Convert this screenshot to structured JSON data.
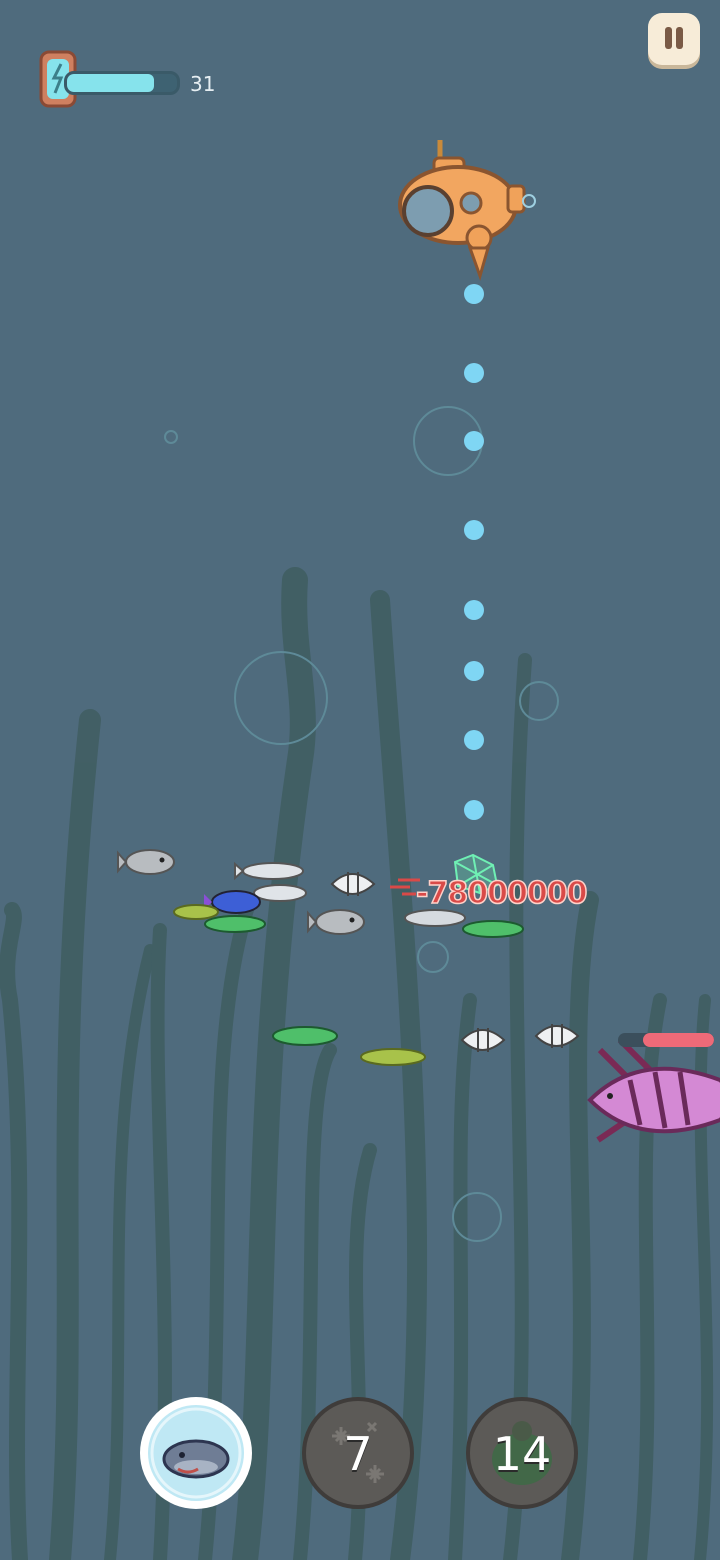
{
  "hud": {
    "energy_value": "31",
    "energy_fraction": 0.79
  },
  "combat": {
    "damage_popup": "-78000000",
    "boss_health_fraction": 0.74
  },
  "skills": [
    {
      "name": "whale-skill",
      "count": "",
      "ready": true
    },
    {
      "name": "freeze-skill",
      "count": "7",
      "ready": false
    },
    {
      "name": "poison-skill",
      "count": "14",
      "ready": false
    }
  ],
  "colors": {
    "water": "#4f6b7d",
    "seaweed": "#3f5d60",
    "energy": "#86e3ec",
    "trajectory": "#7fd6f4",
    "damage": "#d94a48",
    "boss": "#b05aa8"
  },
  "icons": {
    "pause": "pause-icon",
    "energy": "energy-canister-icon",
    "freeze": "snowflake-icon",
    "poison": "poison-fish-icon",
    "whale": "whale-icon"
  }
}
